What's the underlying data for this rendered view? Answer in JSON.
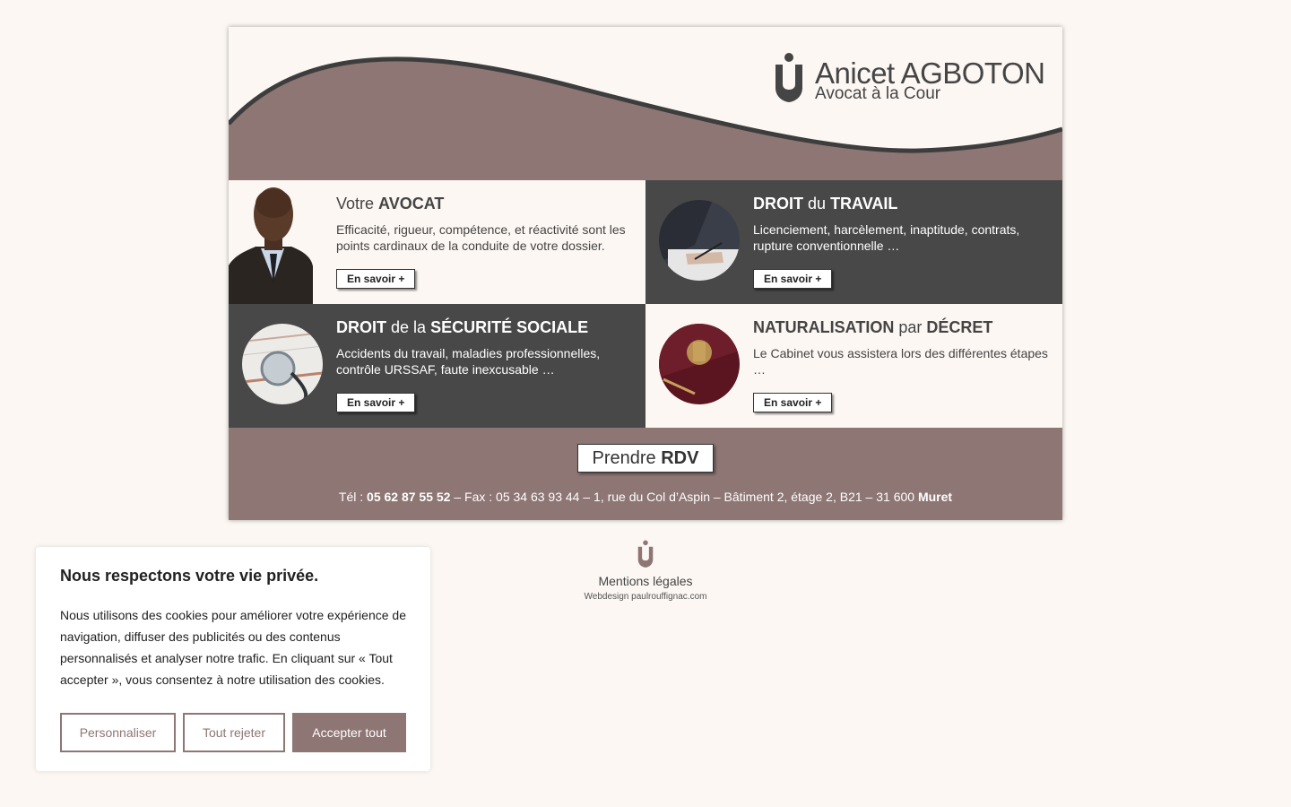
{
  "colors": {
    "accent": "#8e7674",
    "dark": "#484848",
    "background": "#fcf7f3"
  },
  "header": {
    "logo_icon": "lawyer-logo-icon",
    "name_first": "Anicet",
    "name_last": "AGBOTON",
    "subtitle": "Avocat à la Cour"
  },
  "tiles": [
    {
      "title_pre": "Votre",
      "title_bold": "AVOCAT",
      "title_mid": "",
      "title_bold2": "",
      "text": "Efficacité, rigueur, compétence, et réactivité sont les points cardinaux de la conduite de votre dossier.",
      "button": "En savoir +"
    },
    {
      "title_pre": "",
      "title_bold": "DROIT",
      "title_mid": "du",
      "title_bold2": "TRAVAIL",
      "text": "Licenciement, harcèlement, inaptitude, contrats, rupture conventionnelle  …",
      "button": "En savoir +"
    },
    {
      "title_pre": "",
      "title_bold": "DROIT",
      "title_mid": "de la",
      "title_bold2": "SÉCURITÉ SOCIALE",
      "text": "Accidents du travail, maladies professionnelles, contrôle URSSAF, faute inexcusable …",
      "button": "En savoir +"
    },
    {
      "title_pre": "",
      "title_bold": "NATURALISATION",
      "title_mid": "par",
      "title_bold2": "DÉCRET",
      "text": "Le Cabinet vous assistera lors des différentes étapes …",
      "button": "En savoir +"
    }
  ],
  "footer": {
    "rdv_pre": "Prendre",
    "rdv_bold": "RDV",
    "tel_label": "Tél :",
    "tel": "05 62 87 55 52",
    "address": "– Fax : 05 34 63 93 44 – 1, rue du Col d’Aspin – Bâtiment 2, étage 2, B21 – 31 600",
    "city": "Muret"
  },
  "below": {
    "legal": "Mentions légales",
    "webdesign": "Webdesign paulrouffignac.com"
  },
  "cookie": {
    "title": "Nous respectons votre vie privée.",
    "text": "Nous utilisons des cookies pour améliorer votre expérience de navigation, diffuser des publicités ou des contenus personnalisés et analyser notre trafic. En cliquant sur « Tout accepter », vous consentez à notre utilisation des cookies.",
    "customize": "Personnaliser",
    "reject": "Tout rejeter",
    "accept": "Accepter tout"
  }
}
